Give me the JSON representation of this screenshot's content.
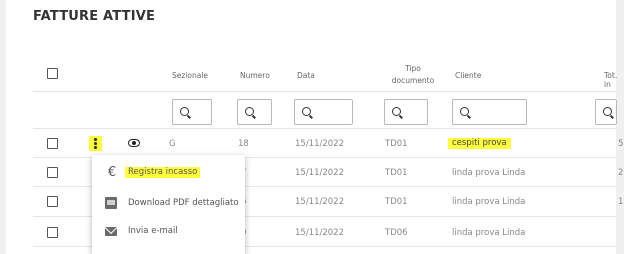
{
  "page": {
    "title": "FATTURE ATTIVE"
  },
  "table": {
    "headers": {
      "sezionale": "Sezionale",
      "numero": "Numero",
      "data": "Data",
      "tipo_line1": "Tipo",
      "tipo_line2": "documento",
      "cliente": "Cliente",
      "totale": "Tot. in"
    },
    "rows": [
      {
        "sezionale": "G",
        "numero": "18",
        "data": "15/11/2022",
        "tipo": "TD01",
        "cliente": "cespiti prova",
        "totale": "5"
      },
      {
        "sezionale": "",
        "numero": "7",
        "data": "15/11/2022",
        "tipo": "TD01",
        "cliente": "linda prova Linda",
        "totale": "2"
      },
      {
        "sezionale": "",
        "numero": "6",
        "data": "15/11/2022",
        "tipo": "TD01",
        "cliente": "linda prova Linda",
        "totale": "1"
      },
      {
        "sezionale": "",
        "numero": "9",
        "data": "15/11/2022",
        "tipo": "TD06",
        "cliente": "linda prova Linda",
        "totale": ""
      }
    ]
  },
  "context_menu": {
    "items": [
      {
        "label": "Registra incasso",
        "icon": "euro-icon"
      },
      {
        "label": "Download PDF dettagliato",
        "icon": "pdf-icon"
      },
      {
        "label": "Invia e-mail",
        "icon": "email-icon"
      }
    ],
    "euro_glyph": "€"
  },
  "colors": {
    "highlight": "#ffff3c"
  }
}
